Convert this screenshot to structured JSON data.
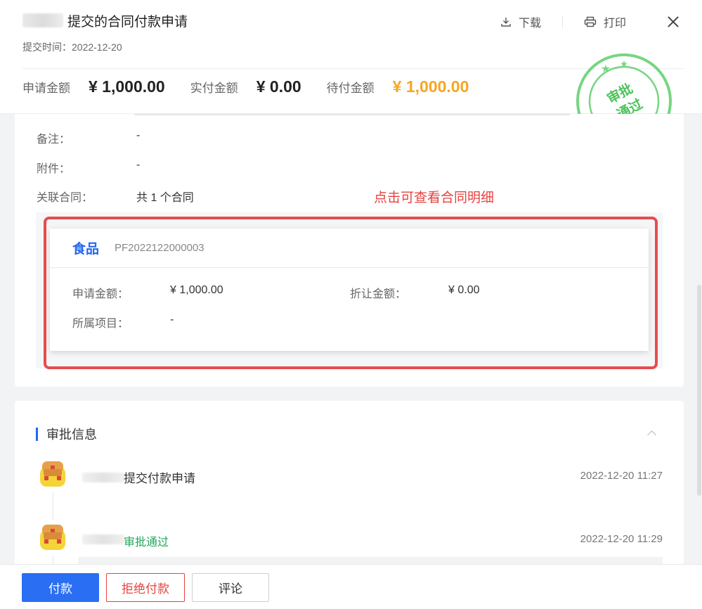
{
  "header": {
    "title": "提交的合同付款申请",
    "submit_time": "提交时间：2022-12-20",
    "download_label": "下载",
    "print_label": "打印"
  },
  "amounts": [
    {
      "label": "申请金额",
      "value": "¥ 1,000.00"
    },
    {
      "label": "实付金额",
      "value": "¥ 0.00"
    },
    {
      "label": "待付金额",
      "value": "¥ 1,000.00"
    }
  ],
  "stamp": {
    "line1": "审批",
    "line2": "通过"
  },
  "details": {
    "remark_label": "备注：",
    "remark_value": "-",
    "attachment_label": "附件：",
    "attachment_value": "-",
    "contract_label": "关联合同：",
    "contract_value": "共 1 个合同"
  },
  "hint": "点击可查看合同明细",
  "contract": {
    "name": "食品",
    "code": "PF2022122000003",
    "apply_label": "申请金额：",
    "apply_value": "¥ 1,000.00",
    "discount_label": "折让金额：",
    "discount_value": "¥ 0.00",
    "project_label": "所属项目：",
    "project_value": "-"
  },
  "approval": {
    "title": "审批信息",
    "items": [
      {
        "action": "提交付款申请",
        "time": "2022-12-20 11:27"
      },
      {
        "action": "审批通过",
        "time": "2022-12-20 11:29"
      }
    ]
  },
  "footer": {
    "pay": "付款",
    "reject": "拒绝付款",
    "comment": "评论"
  },
  "colors": {
    "primary": "#2a6ff3",
    "danger": "#e64340",
    "pending": "#f6a623",
    "success": "#1fa85a",
    "stamp": "#5fcf6b"
  }
}
